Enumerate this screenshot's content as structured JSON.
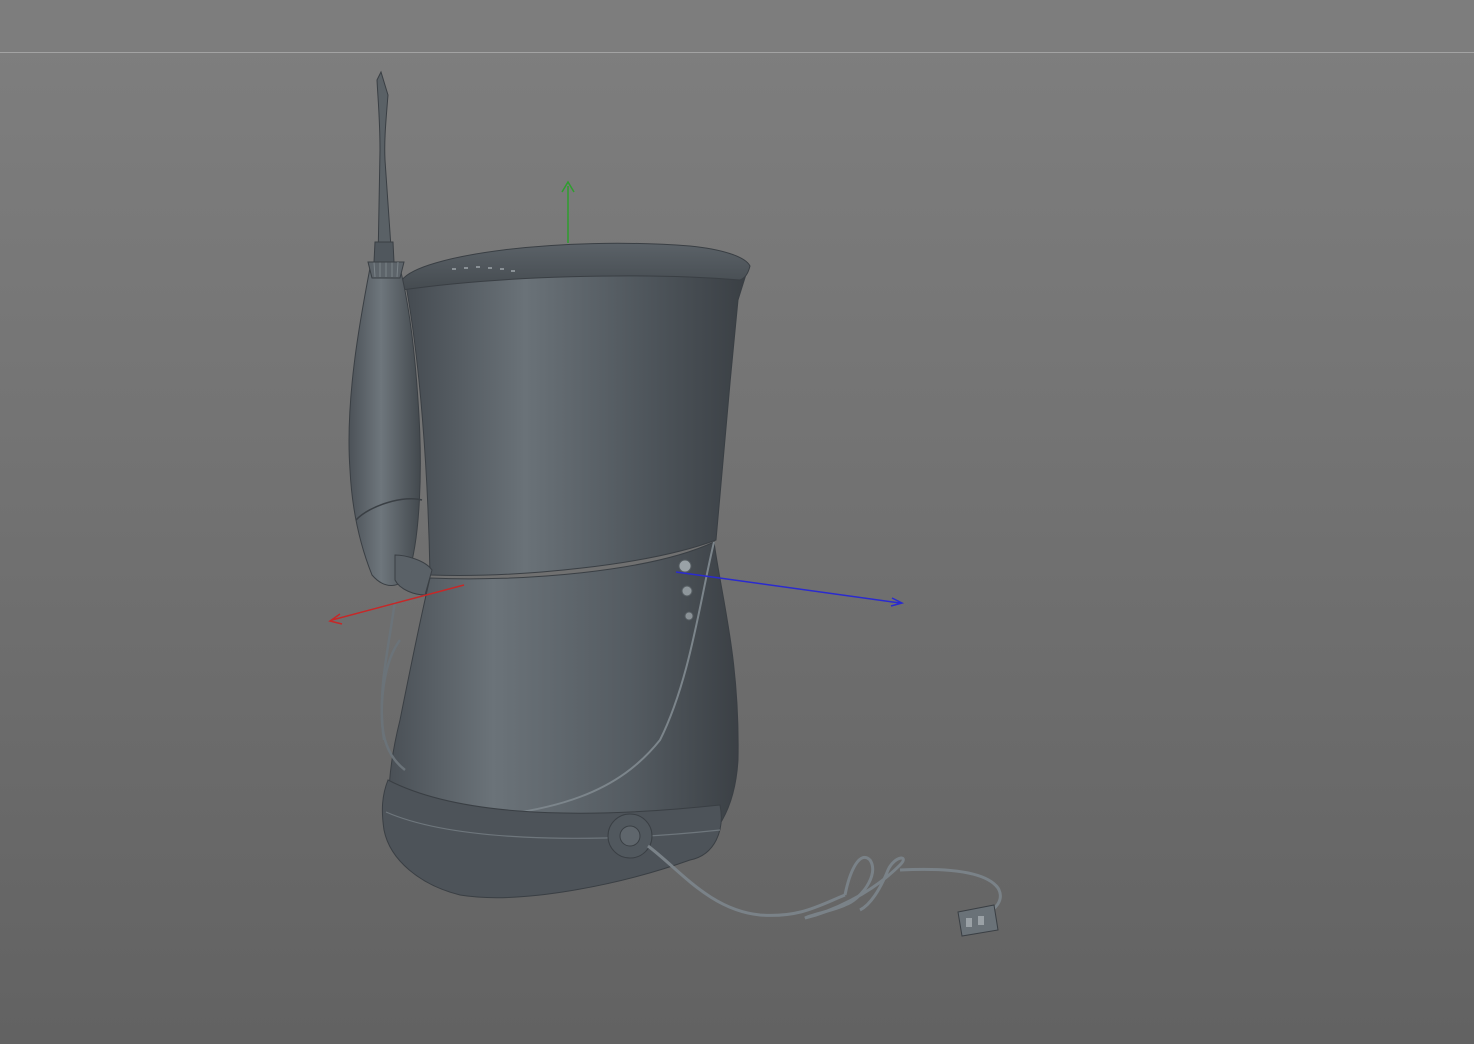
{
  "viewport": {
    "mode": "3d-perspective",
    "background_top": "#7f7f7f",
    "background_bottom": "#626262",
    "header_line_color": "#a3a3a3"
  },
  "model": {
    "name": "",
    "shading_color": "#5d646b"
  },
  "axes": {
    "x_color": "#c62828",
    "y_color": "#2e9e2e",
    "z_color": "#2a2ad0"
  }
}
